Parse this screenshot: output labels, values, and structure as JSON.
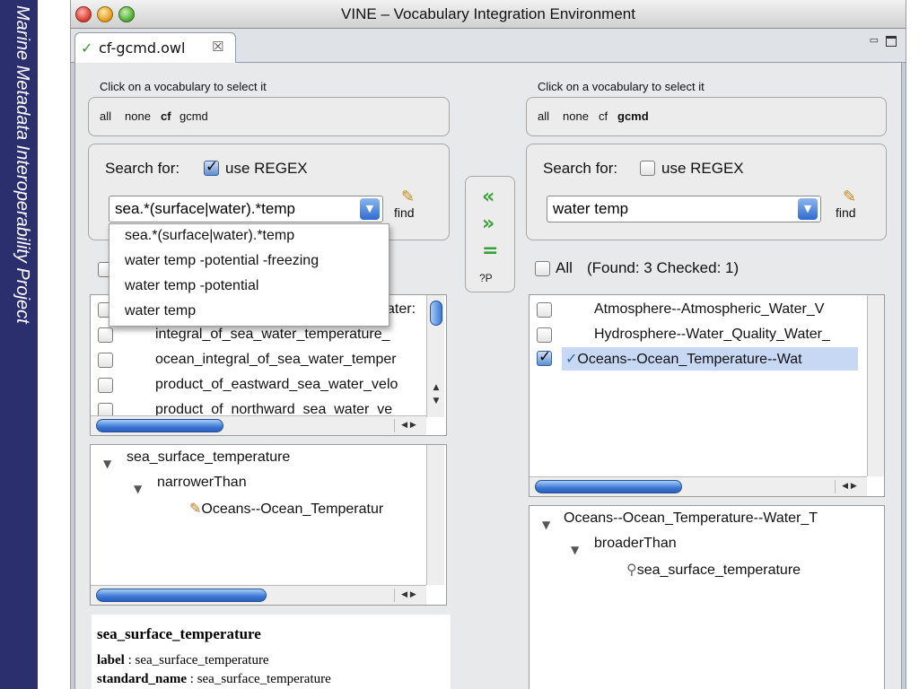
{
  "sidebar": {
    "text": "Marine Metadata Interoperability Project"
  },
  "window": {
    "title": "VINE – Vocabulary Integration Environment"
  },
  "tab": {
    "label": "cf-gcmd.owl",
    "close": "☒"
  },
  "left": {
    "vocab_hint": "Click on a vocabulary to select it",
    "vocab": {
      "all": "all",
      "none": "none",
      "cf": "cf",
      "gcmd": "gcmd"
    },
    "search_label": "Search for:",
    "regex_label": "use REGEX",
    "regex_checked": true,
    "query": "sea.*(surface|water).*temp",
    "find": "find",
    "dropdown": [
      "sea.*(surface|water).*temp",
      "water temp  -potential -freezing",
      "water temp  -potential",
      "water temp"
    ],
    "list_first_partial": "ater:",
    "list": [
      "integral_of_sea_water_temperature_",
      "ocean_integral_of_sea_water_temper",
      "product_of_eastward_sea_water_velo",
      "product_of_northward_sea_water_ve"
    ],
    "tree": {
      "root": "sea_surface_temperature",
      "rel": "narrowerThan",
      "leaf": "Oceans--Ocean_Temperatur"
    },
    "details": {
      "name": "sea_surface_temperature",
      "label_key": "label",
      "label_val": "sea_surface_temperature",
      "std_key": "standard_name",
      "std_val": "sea_surface_temperature"
    }
  },
  "mid": {
    "left": "«",
    "right": "»",
    "eq": "=",
    "qp": "?P"
  },
  "right": {
    "vocab_hint": "Click on a vocabulary to select it",
    "vocab": {
      "all": "all",
      "none": "none",
      "cf": "cf",
      "gcmd": "gcmd"
    },
    "search_label": "Search for:",
    "regex_label": "use REGEX",
    "regex_checked": false,
    "query": "water temp",
    "find": "find",
    "all_label": "All",
    "found": "(Found: 3 Checked: 1)",
    "list": [
      "Atmosphere--Atmospheric_Water_V",
      "Hydrosphere--Water_Quality_Water_",
      "Oceans--Ocean_Temperature--Wat"
    ],
    "tree": {
      "root": "Oceans--Ocean_Temperature--Water_T",
      "rel": "broaderThan",
      "leaf": "sea_surface_temperature"
    }
  },
  "colors": {
    "sidebar": "#2b2f6e",
    "accent": "#3b78d6",
    "selection": "#c7d8f4",
    "arrow": "#3aa03a"
  }
}
